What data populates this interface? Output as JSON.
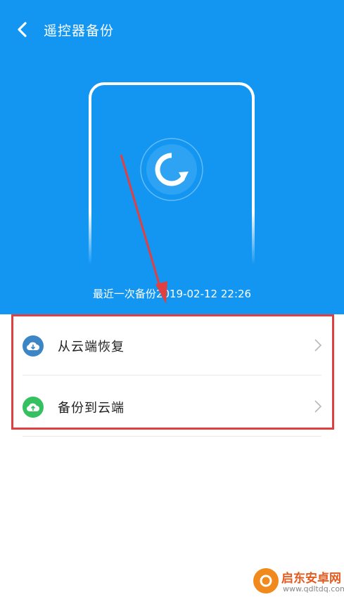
{
  "header": {
    "title": "遥控器备份"
  },
  "hero": {
    "last_backup_label": "最近一次备份",
    "last_backup_time": "2019-02-12 22:26"
  },
  "actions": [
    {
      "label": "从云端恢复",
      "icon": "cloud-download-icon",
      "color": "#3d86c6"
    },
    {
      "label": "备份到云端",
      "icon": "cloud-upload-icon",
      "color": "#35c160"
    }
  ],
  "colors": {
    "primary": "#1296f2",
    "highlight": "#e04040"
  },
  "watermark": {
    "title": "启东安卓网",
    "url": "www.qdltdq.com"
  }
}
